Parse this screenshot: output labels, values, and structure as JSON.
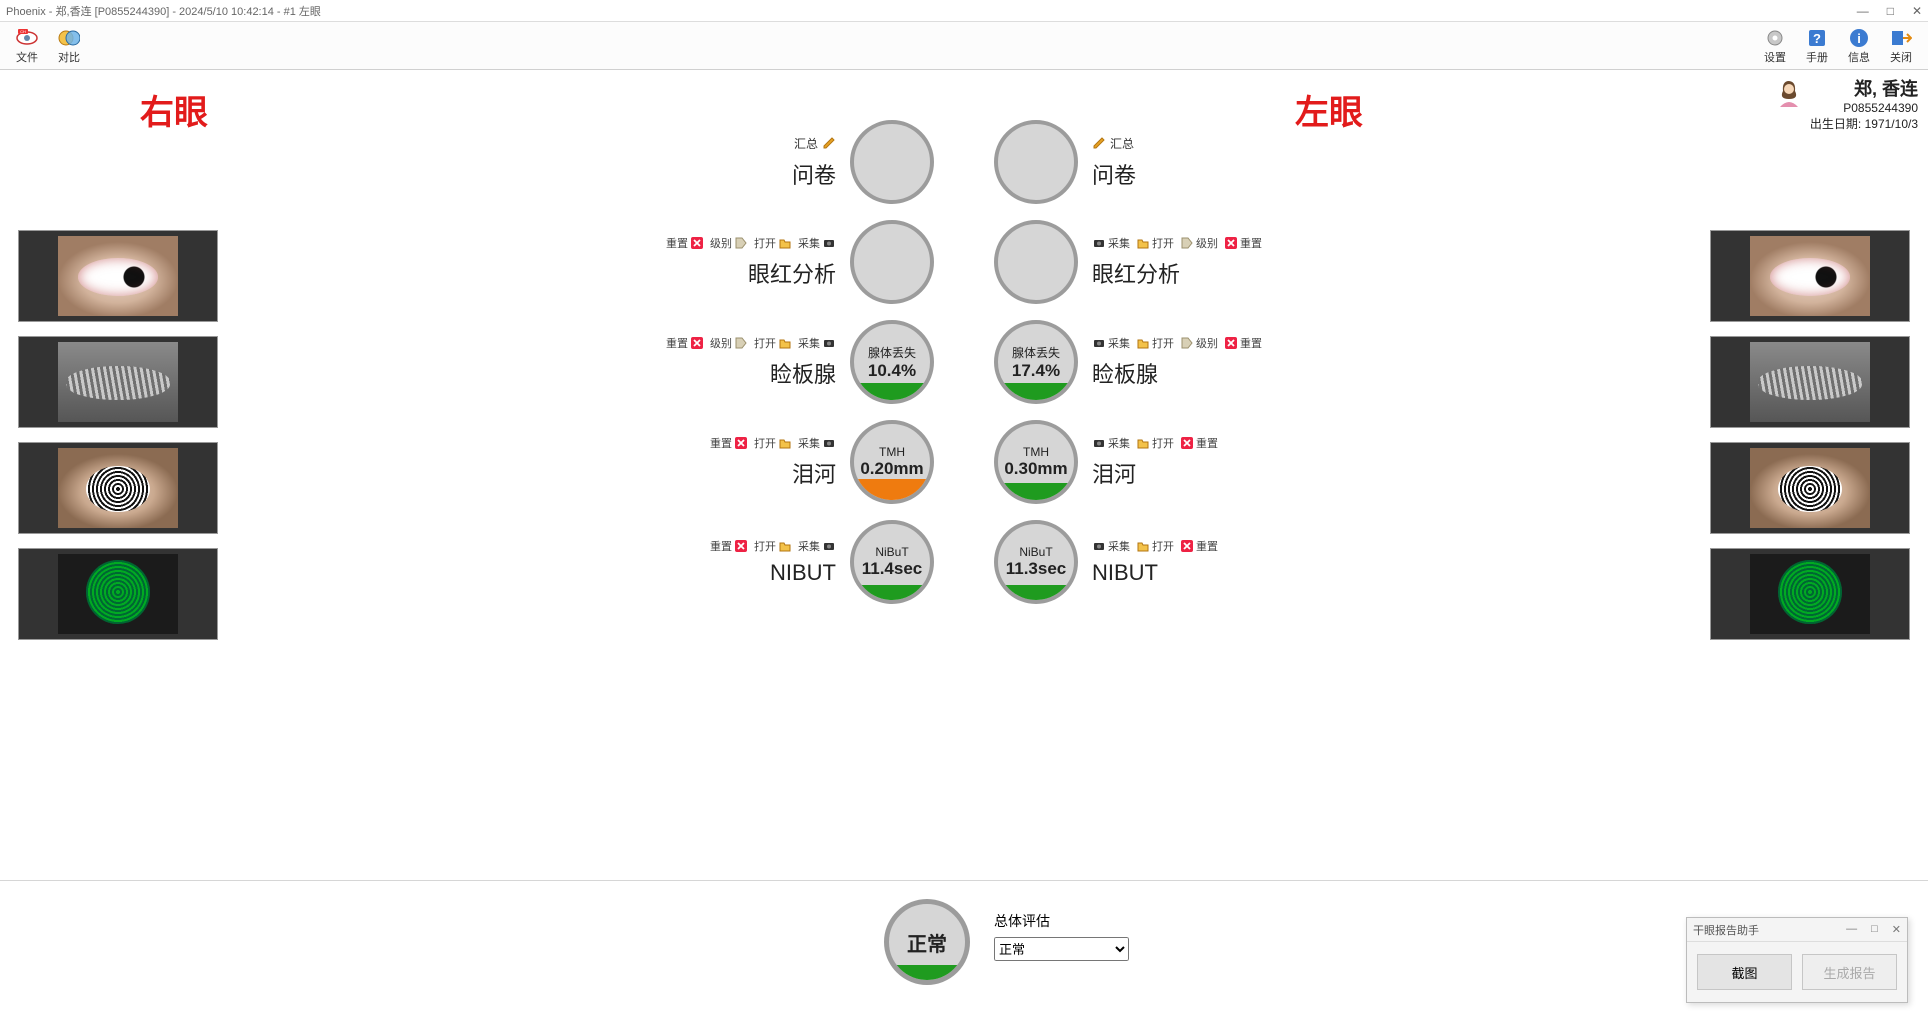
{
  "title": "Phoenix - 郑,香连 [P0855244390] - 2024/5/10 10:42:14 - #1 左眼",
  "toolbar": {
    "left": [
      {
        "id": "file",
        "label": "文件"
      },
      {
        "id": "compare",
        "label": "对比"
      }
    ],
    "right": [
      {
        "id": "settings",
        "label": "设置"
      },
      {
        "id": "manual",
        "label": "手册"
      },
      {
        "id": "info",
        "label": "信息"
      },
      {
        "id": "close",
        "label": "关闭"
      }
    ]
  },
  "eyes": {
    "right": "右眼",
    "left": "左眼"
  },
  "patient": {
    "name": "郑, 香连",
    "id": "P0855244390",
    "dob_label": "出生日期:",
    "dob": "1971/10/3"
  },
  "actions": {
    "reset": "重置",
    "grade": "级别",
    "open": "打开",
    "capture": "采集",
    "summary": "汇总"
  },
  "tests": {
    "questionnaire": {
      "name": "问卷"
    },
    "redness": {
      "name": "眼红分析"
    },
    "meibomian": {
      "name": "睑板腺",
      "caption": "腺体丢失",
      "right": {
        "value": "10.4%",
        "fill": 22,
        "color": "green"
      },
      "left": {
        "value": "17.4%",
        "fill": 22,
        "color": "green"
      }
    },
    "tearriver": {
      "name": "泪河",
      "caption": "TMH",
      "right": {
        "value": "0.20mm",
        "fill": 28,
        "color": "orange"
      },
      "left": {
        "value": "0.30mm",
        "fill": 22,
        "color": "green"
      }
    },
    "nibut": {
      "name": "NIBUT",
      "caption": "NiBuT",
      "right": {
        "value": "11.4sec",
        "fill": 20,
        "color": "green"
      },
      "left": {
        "value": "11.3sec",
        "fill": 20,
        "color": "green"
      }
    }
  },
  "overall": {
    "label": "总体评估",
    "value": "正常",
    "options": [
      "正常"
    ]
  },
  "helper": {
    "title": "干眼报告助手",
    "screenshot": "截图",
    "generate": "生成报告"
  }
}
